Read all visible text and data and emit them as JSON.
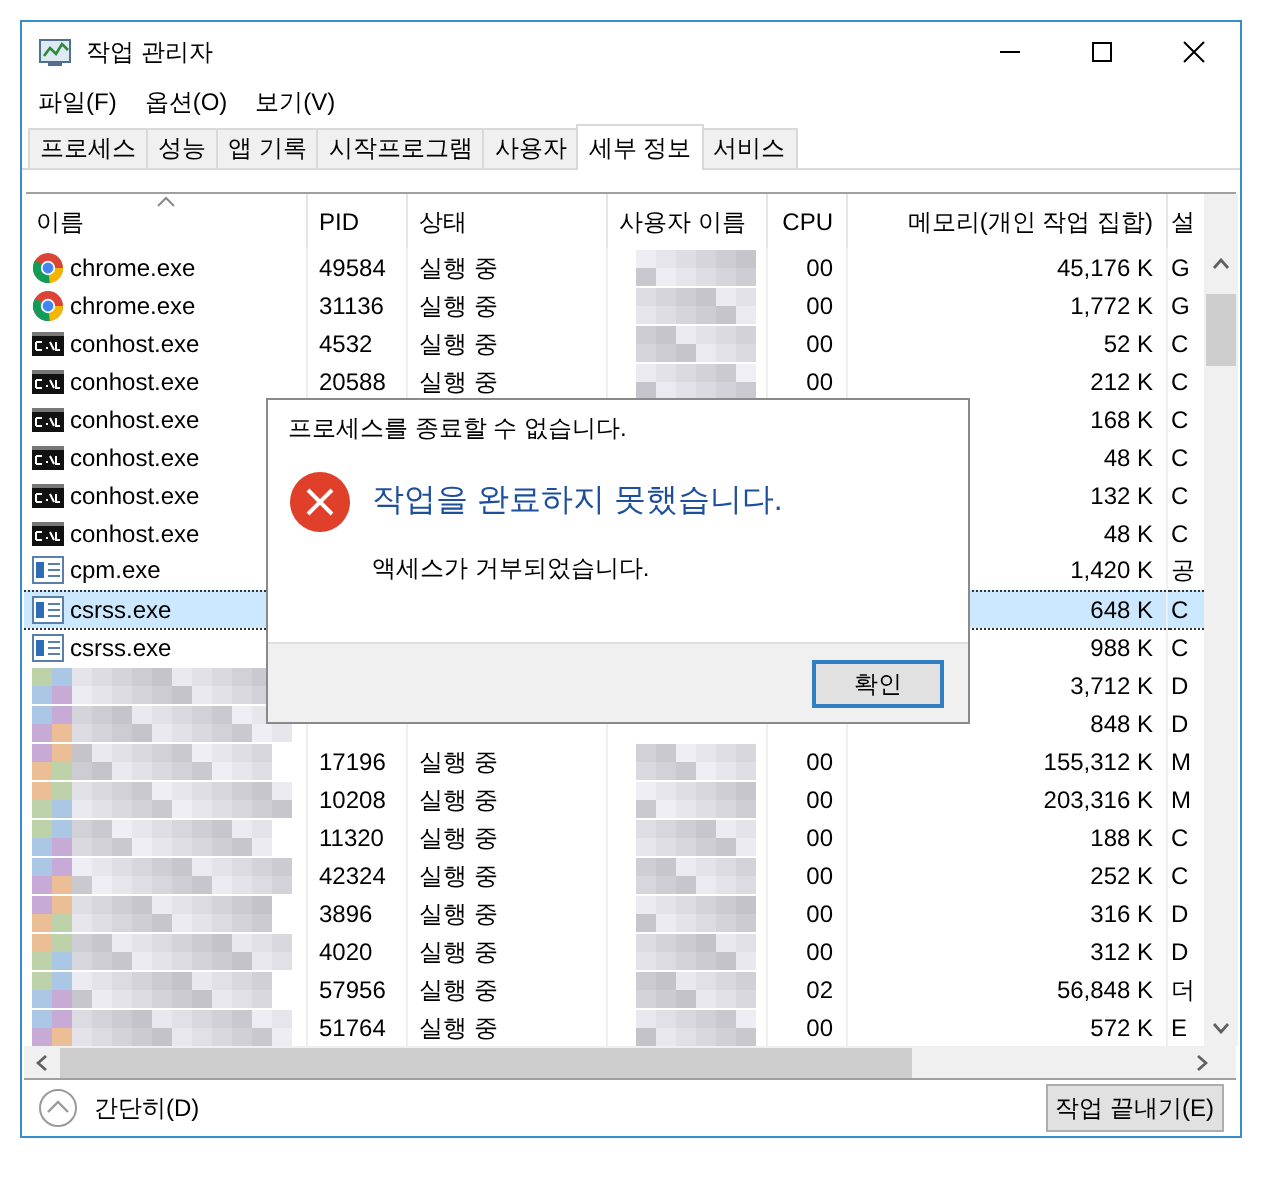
{
  "window": {
    "title": "작업 관리자"
  },
  "menu": [
    "파일(F)",
    "옵션(O)",
    "보기(V)"
  ],
  "tabs": [
    {
      "label": "프로세스",
      "selected": false
    },
    {
      "label": "성능",
      "selected": false
    },
    {
      "label": "앱 기록",
      "selected": false
    },
    {
      "label": "시작프로그램",
      "selected": false
    },
    {
      "label": "사용자",
      "selected": false
    },
    {
      "label": "세부 정보",
      "selected": true
    },
    {
      "label": "서비스",
      "selected": false
    }
  ],
  "table": {
    "columns": [
      "이름",
      "PID",
      "상태",
      "사용자 이름",
      "CPU",
      "메모리(개인 작업 집합)",
      "설"
    ],
    "rows": [
      {
        "kind": "chrome",
        "name": "chrome.exe",
        "pid": "49584",
        "status": "실행 중",
        "user_blurred": true,
        "cpu": "00",
        "memory": "45,176 K",
        "column_7": "G",
        "selected": false
      },
      {
        "kind": "chrome",
        "name": "chrome.exe",
        "pid": "31136",
        "status": "실행 중",
        "user_blurred": true,
        "cpu": "00",
        "memory": "1,772 K",
        "column_7": "G",
        "selected": false
      },
      {
        "kind": "console",
        "name": "conhost.exe",
        "pid": "4532",
        "status": "실행 중",
        "user_blurred": true,
        "cpu": "00",
        "memory": "52 K",
        "column_7": "C",
        "selected": false
      },
      {
        "kind": "console",
        "name": "conhost.exe",
        "pid": "20588",
        "status": "실행 중",
        "user_blurred": true,
        "cpu": "00",
        "memory": "212 K",
        "column_7": "C",
        "selected": false
      },
      {
        "kind": "console",
        "name": "conhost.exe",
        "memory": "168 K",
        "column_7": "C",
        "selected": false
      },
      {
        "kind": "console",
        "name": "conhost.exe",
        "memory": "48 K",
        "column_7": "C",
        "selected": false
      },
      {
        "kind": "console",
        "name": "conhost.exe",
        "memory": "132 K",
        "column_7": "C",
        "selected": false
      },
      {
        "kind": "console",
        "name": "conhost.exe",
        "memory": "48 K",
        "column_7": "C",
        "selected": false
      },
      {
        "kind": "app",
        "name": "cpm.exe",
        "memory": "1,420 K",
        "column_7": "공",
        "selected": false
      },
      {
        "kind": "app",
        "name": "csrss.exe",
        "memory": "648 K",
        "column_7": "C",
        "selected": true
      },
      {
        "kind": "app",
        "name": "csrss.exe",
        "memory": "988 K",
        "column_7": "C",
        "selected": false
      },
      {
        "kind": "redacted",
        "memory": "3,712 K",
        "column_7": "D",
        "selected": false
      },
      {
        "kind": "redacted",
        "memory": "848 K",
        "column_7": "D",
        "selected": false
      },
      {
        "kind": "redacted",
        "pid": "17196",
        "status": "실행 중",
        "user_blurred": true,
        "cpu": "00",
        "memory": "155,312 K",
        "column_7": "M",
        "selected": false
      },
      {
        "kind": "redacted",
        "pid": "10208",
        "status": "실행 중",
        "user_blurred": true,
        "cpu": "00",
        "memory": "203,316 K",
        "column_7": "M",
        "selected": false
      },
      {
        "kind": "redacted",
        "pid": "11320",
        "status": "실행 중",
        "user_blurred": true,
        "cpu": "00",
        "memory": "188 K",
        "column_7": "C",
        "selected": false
      },
      {
        "kind": "redacted",
        "pid": "42324",
        "status": "실행 중",
        "user_blurred": true,
        "cpu": "00",
        "memory": "252 K",
        "column_7": "C",
        "selected": false
      },
      {
        "kind": "redacted",
        "pid": "3896",
        "status": "실행 중",
        "user_blurred": true,
        "cpu": "00",
        "memory": "316 K",
        "column_7": "D",
        "selected": false
      },
      {
        "kind": "redacted",
        "pid": "4020",
        "status": "실행 중",
        "user_blurred": true,
        "cpu": "00",
        "memory": "312 K",
        "column_7": "D",
        "selected": false
      },
      {
        "kind": "redacted",
        "pid": "57956",
        "status": "실행 중",
        "user_blurred": true,
        "cpu": "02",
        "memory": "56,848 K",
        "column_7": "더",
        "selected": false
      },
      {
        "kind": "redacted",
        "pid": "51764",
        "status": "실행 중",
        "user_blurred": true,
        "cpu": "00",
        "memory": "572 K",
        "column_7": "E",
        "selected": false
      }
    ]
  },
  "dialog": {
    "title": "프로세스를 종료할 수 없습니다.",
    "heading": "작업을 완료하지 못했습니다.",
    "message": "액세스가 거부되었습니다.",
    "button": "확인"
  },
  "footer": {
    "toggle": "간단히(D)",
    "button": "작업 끝내기(E)"
  }
}
